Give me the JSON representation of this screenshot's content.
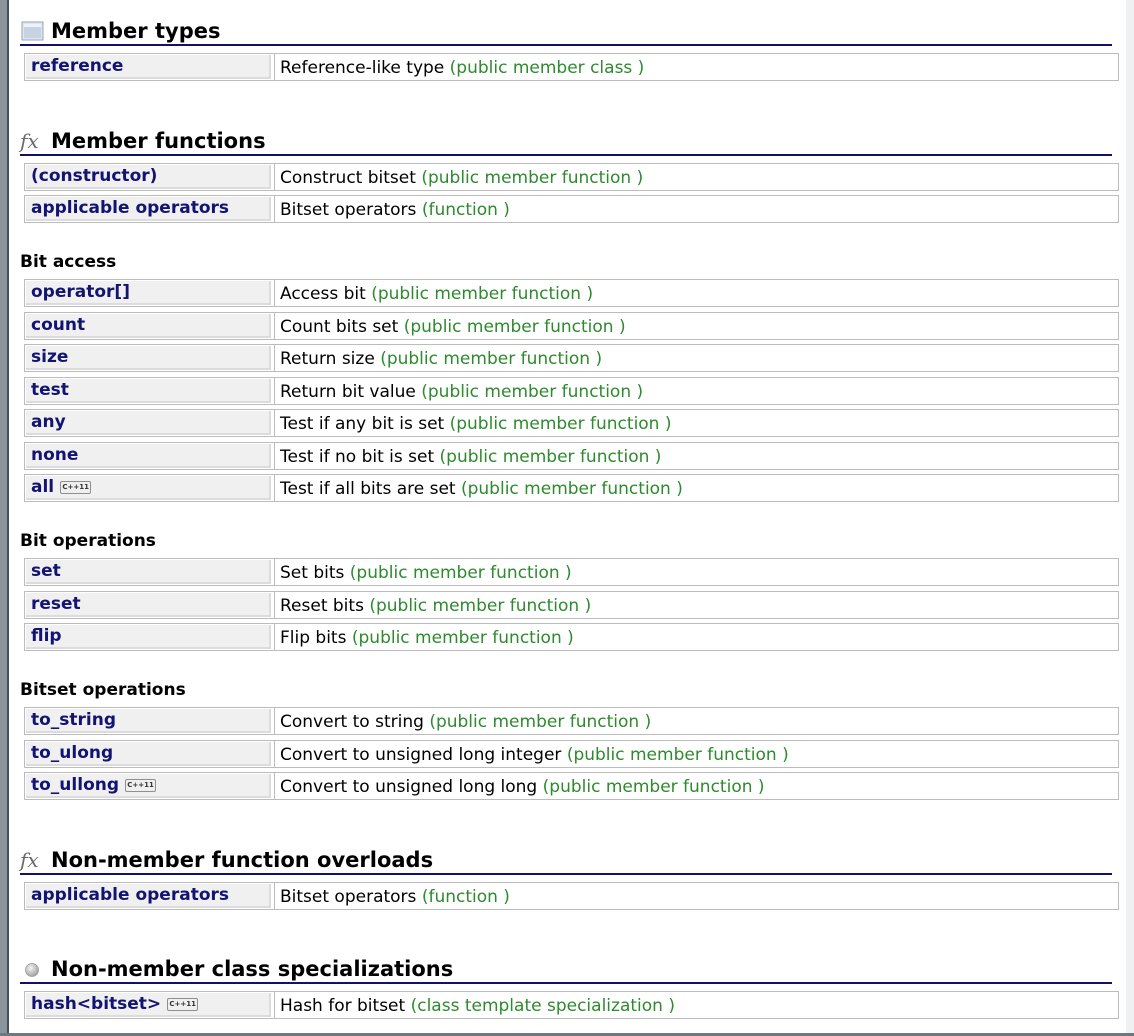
{
  "sections": {
    "member_types": {
      "title": "Member types",
      "rows": [
        {
          "name": "reference",
          "desc": "Reference-like type",
          "cat": "(public member class )"
        }
      ]
    },
    "member_functions": {
      "title": "Member functions",
      "icon_text": "fx",
      "rows": [
        {
          "name": "(constructor)",
          "desc": "Construct bitset",
          "cat": "(public member function )"
        },
        {
          "name": "applicable operators",
          "desc": "Bitset operators",
          "cat": "(function )"
        }
      ]
    },
    "bit_access": {
      "title": "Bit access",
      "rows": [
        {
          "name": "operator[]",
          "desc": "Access bit",
          "cat": "(public member function )"
        },
        {
          "name": "count",
          "desc": "Count bits set",
          "cat": "(public member function )"
        },
        {
          "name": "size",
          "desc": "Return size",
          "cat": "(public member function )"
        },
        {
          "name": "test",
          "desc": "Return bit value",
          "cat": "(public member function )"
        },
        {
          "name": "any",
          "desc": "Test if any bit is set",
          "cat": "(public member function )"
        },
        {
          "name": "none",
          "desc": "Test if no bit is set",
          "cat": "(public member function )"
        },
        {
          "name": "all",
          "badge": "C++11",
          "desc": "Test if all bits are set",
          "cat": "(public member function )"
        }
      ]
    },
    "bit_operations": {
      "title": "Bit operations",
      "rows": [
        {
          "name": "set",
          "desc": "Set bits",
          "cat": "(public member function )"
        },
        {
          "name": "reset",
          "desc": "Reset bits",
          "cat": "(public member function )"
        },
        {
          "name": "flip",
          "desc": "Flip bits",
          "cat": "(public member function )"
        }
      ]
    },
    "bitset_operations": {
      "title": "Bitset operations",
      "rows": [
        {
          "name": "to_string",
          "desc": "Convert to string",
          "cat": "(public member function )"
        },
        {
          "name": "to_ulong",
          "desc": "Convert to unsigned long integer",
          "cat": "(public member function )"
        },
        {
          "name": "to_ullong",
          "badge": "C++11",
          "desc": "Convert to unsigned long long",
          "cat": "(public member function )"
        }
      ]
    },
    "nonmember_overloads": {
      "title": "Non-member function overloads",
      "icon_text": "fx",
      "rows": [
        {
          "name": "applicable operators",
          "desc": "Bitset operators",
          "cat": "(function )"
        }
      ]
    },
    "nonmember_specializations": {
      "title": "Non-member class specializations",
      "rows": [
        {
          "name": "hash<bitset>",
          "badge": "C++11",
          "desc": "Hash for bitset",
          "cat": "(class template specialization )"
        }
      ]
    }
  },
  "colors": {
    "link_name": "#131372",
    "category_green": "#2d8a2d",
    "title_rule": "#11116a",
    "name_cell_bg": "#f0f0f0"
  }
}
